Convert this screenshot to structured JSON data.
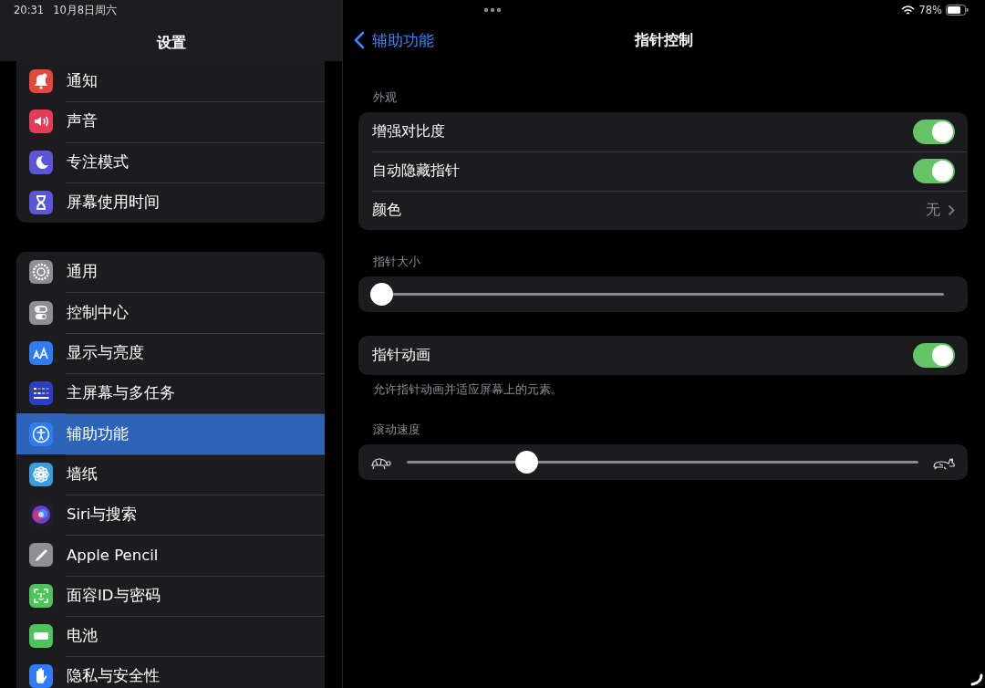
{
  "status_bar": {
    "time": "20:31",
    "date": "10月8日周六",
    "battery": "78%"
  },
  "sidebar": {
    "title": "设置",
    "groups": [
      [
        {
          "label": "通知",
          "kind": "bell",
          "color": "#e5473d",
          "selected": false
        },
        {
          "label": "声音",
          "kind": "speaker",
          "color": "#e53b56",
          "selected": false
        },
        {
          "label": "专注模式",
          "kind": "moon",
          "color": "#5a56d6",
          "selected": false
        },
        {
          "label": "屏幕使用时间",
          "kind": "hourglass",
          "color": "#5a56d6",
          "selected": false
        }
      ],
      [
        {
          "label": "通用",
          "kind": "gear",
          "color": "#8e8e93",
          "selected": false
        },
        {
          "label": "控制中心",
          "kind": "switches",
          "color": "#8e8e93",
          "selected": false
        },
        {
          "label": "显示与亮度",
          "kind": "text",
          "color": "#2f7cf6",
          "selected": false
        },
        {
          "label": "主屏幕与多任务",
          "kind": "grid",
          "color": "#2c3fc4",
          "selected": false
        },
        {
          "label": "辅助功能",
          "kind": "person",
          "color": "#2f7cf6",
          "selected": true
        },
        {
          "label": "墙纸",
          "kind": "flower",
          "color": "#3a9de0",
          "selected": false
        },
        {
          "label": "Siri与搜索",
          "kind": "orb",
          "color": "#1e1e2e",
          "selected": false
        },
        {
          "label": "Apple Pencil",
          "kind": "pencil",
          "color": "#8e8e93",
          "selected": false
        },
        {
          "label": "面容ID与密码",
          "kind": "face",
          "color": "#4cc45a",
          "selected": false
        },
        {
          "label": "电池",
          "kind": "battery",
          "color": "#4cc45a",
          "selected": false
        },
        {
          "label": "隐私与安全性",
          "kind": "hand",
          "color": "#2f7cf6",
          "selected": false
        }
      ]
    ]
  },
  "detail": {
    "back": "辅助功能",
    "title": "指针控制",
    "sections": [
      {
        "header": "外观",
        "rows": [
          {
            "kind": "toggle",
            "label": "增强对比度",
            "on": true
          },
          {
            "kind": "toggle",
            "label": "自动隐藏指针",
            "on": true
          },
          {
            "kind": "disclosure",
            "label": "颜色",
            "value": "无"
          }
        ]
      },
      {
        "header": "指针大小",
        "rows": [
          {
            "kind": "slider",
            "level": 0
          }
        ]
      },
      {
        "rows": [
          {
            "kind": "toggle",
            "label": "指针动画",
            "on": true
          }
        ],
        "footer": "允许指针动画并适应屏幕上的元素。"
      },
      {
        "header": "滚动速度",
        "rows": [
          {
            "kind": "speed_slider",
            "level": 0.235
          }
        ]
      }
    ]
  }
}
